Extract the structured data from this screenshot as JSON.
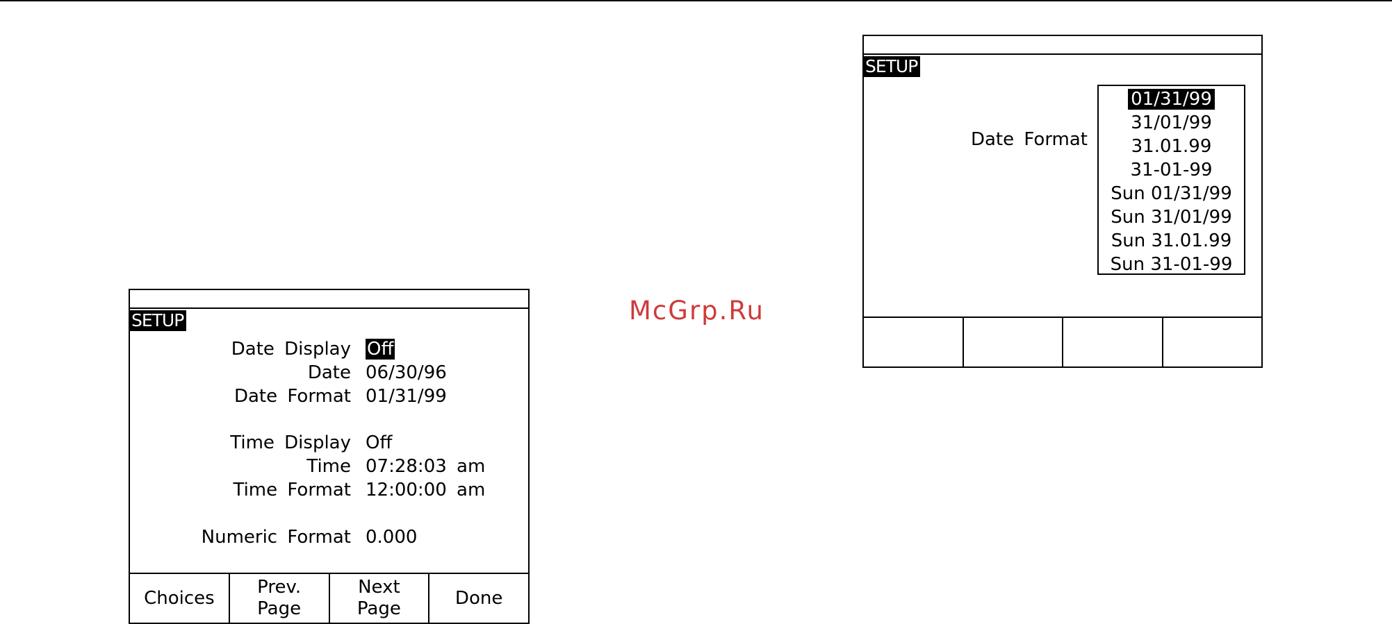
{
  "watermark": "McGrp.Ru",
  "left_screen": {
    "tag": "SETUP",
    "fields": [
      {
        "label": "Date Display",
        "value": "Off",
        "selected": true
      },
      {
        "label": "Date",
        "value": "06/30/96"
      },
      {
        "label": "Date Format",
        "value": "01/31/99"
      },
      {
        "label": "Time Display",
        "value": "Off"
      },
      {
        "label": "Time",
        "value": "07:28:03 am"
      },
      {
        "label": "Time Format",
        "value": "12:00:00 am"
      },
      {
        "label": "Numeric Format",
        "value": "0.000"
      }
    ],
    "softkeys": [
      "Choices",
      "Prev.\nPage",
      "Next\nPage",
      "Done"
    ]
  },
  "right_screen": {
    "tag": "SETUP",
    "field_label": "Date Format",
    "options": [
      "01/31/99",
      "31/01/99",
      "31.01.99",
      "31-01-99",
      "Sun 01/31/99",
      "Sun 31/01/99",
      "Sun 31.01.99",
      "Sun 31-01-99"
    ],
    "selected_option": "01/31/99",
    "softkeys": [
      "",
      "",
      "",
      ""
    ]
  }
}
